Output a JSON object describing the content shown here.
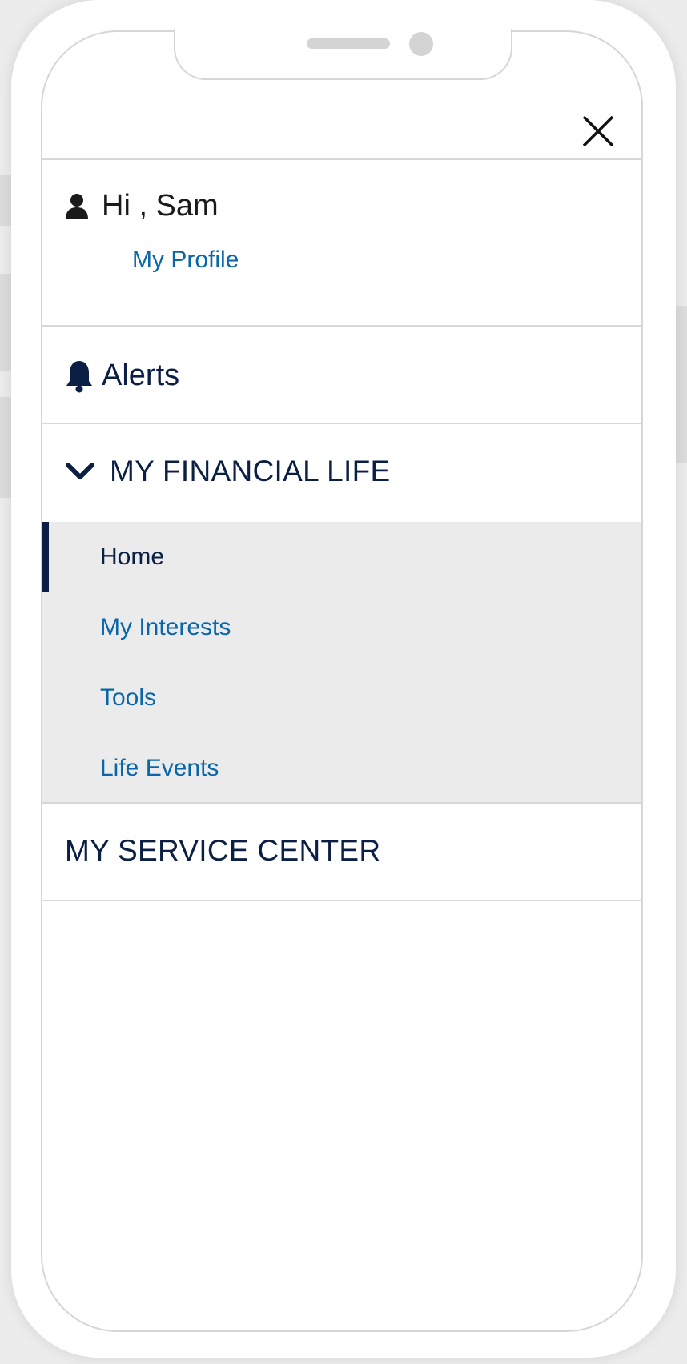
{
  "menu": {
    "greeting": "Hi , Sam",
    "profile_link": "My Profile",
    "alerts": "Alerts",
    "financial_section": {
      "title": "MY FINANCIAL LIFE",
      "expanded": true,
      "items": [
        {
          "label": "Home",
          "active": true
        },
        {
          "label": "My Interests",
          "active": false
        },
        {
          "label": "Tools",
          "active": false
        },
        {
          "label": "Life Events",
          "active": false
        }
      ]
    },
    "service_section": "MY SERVICE CENTER"
  },
  "icons": {
    "close": "close-icon",
    "user": "user-icon",
    "bell": "bell-icon",
    "chevron": "chevron-down-icon"
  },
  "colors": {
    "navy": "#0b1f44",
    "link_blue": "#0a66a8",
    "submenu_bg": "#ebebeb",
    "divider": "#d8d8d8"
  }
}
